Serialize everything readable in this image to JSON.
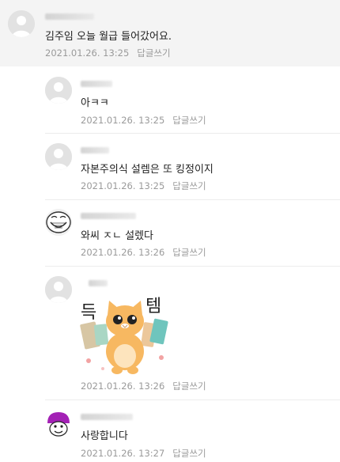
{
  "comments": [
    {
      "text": "김주임 오늘 월급 들어갔어요.",
      "date": "2021.01.26. 13:25",
      "reply": "답글쓰기",
      "avatar_icon": "default-avatar-icon"
    },
    {
      "text": "아ㅋㅋ",
      "date": "2021.01.26. 13:25",
      "reply": "답글쓰기",
      "avatar_icon": "default-avatar-icon"
    },
    {
      "text": "자본주의식 설렘은 또 킹정이지",
      "date": "2021.01.26. 13:25",
      "reply": "답글쓰기",
      "avatar_icon": "default-avatar-icon"
    },
    {
      "text": "와씨 ㅈㄴ 설렜다",
      "date": "2021.01.26. 13:26",
      "reply": "답글쓰기",
      "avatar_icon": "trollface-avatar-icon"
    },
    {
      "text": "",
      "date": "2021.01.26. 13:26",
      "reply": "답글쓰기",
      "avatar_icon": "default-avatar-icon",
      "sticker": {
        "left_text": "득",
        "right_text": "템",
        "icon": "cat-with-shopping-bags-sticker"
      }
    },
    {
      "text": "사랑합니다",
      "date": "2021.01.26. 13:27",
      "reply": "답글쓰기",
      "avatar_icon": "purple-character-avatar-icon"
    }
  ],
  "colors": {
    "top_bg": "#f4f4f4",
    "meta": "#9a9a9a",
    "text": "#1e1e1e"
  }
}
